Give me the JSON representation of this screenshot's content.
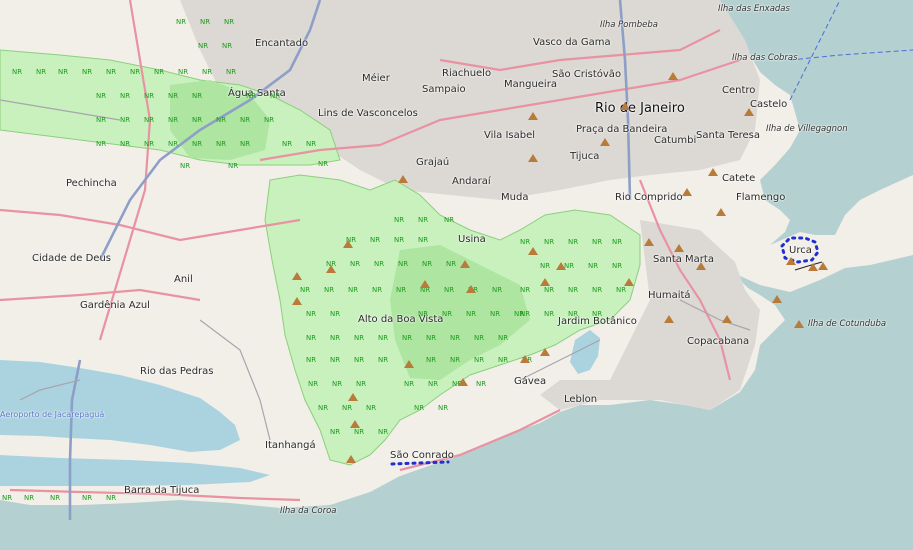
{
  "colors": {
    "sea": "#b5d0d0",
    "land": "#f2efe9",
    "urban": "#dcd9d4",
    "park": "#c8f1bd",
    "park_dark": "#aee5a1",
    "lagoon": "#aad3df",
    "road_major": "#e892a2",
    "road_motorway": "#8d9fc7",
    "route": "#1f2fd0"
  },
  "map": {
    "places": [
      {
        "id": "encantado",
        "name": "Encantado"
      },
      {
        "id": "agua-santa",
        "name": "Água Santa"
      },
      {
        "id": "meier",
        "name": "Méier"
      },
      {
        "id": "riachuelo",
        "name": "Riachuelo"
      },
      {
        "id": "vasco",
        "name": "Vasco da Gama"
      },
      {
        "id": "ilha-pombeba",
        "name": "Ilha Pombeba",
        "kind": "island"
      },
      {
        "id": "ilha-enxadas",
        "name": "Ilha das Enxadas",
        "kind": "island"
      },
      {
        "id": "ilha-cobras",
        "name": "Ilha das Cobras",
        "kind": "island"
      },
      {
        "id": "sampaio",
        "name": "Sampaio"
      },
      {
        "id": "mangueira",
        "name": "Mangueira"
      },
      {
        "id": "sao-cristovao",
        "name": "São Cristóvão"
      },
      {
        "id": "rio",
        "name": "Rio de Janeiro",
        "kind": "big"
      },
      {
        "id": "centro",
        "name": "Centro"
      },
      {
        "id": "castelo",
        "name": "Castelo"
      },
      {
        "id": "lins",
        "name": "Lins de Vasconcelos"
      },
      {
        "id": "vila-isabel",
        "name": "Vila Isabel"
      },
      {
        "id": "praca-bandeira",
        "name": "Praça da Bandeira"
      },
      {
        "id": "catumbi",
        "name": "Catumbi"
      },
      {
        "id": "santa-teresa",
        "name": "Santa Teresa"
      },
      {
        "id": "ilha-villegagnon",
        "name": "Ilha de Villegagnon",
        "kind": "island"
      },
      {
        "id": "grajau",
        "name": "Grajaú"
      },
      {
        "id": "tijuca",
        "name": "Tijuca"
      },
      {
        "id": "pechincha",
        "name": "Pechincha"
      },
      {
        "id": "andarai",
        "name": "Andaraí"
      },
      {
        "id": "catete",
        "name": "Catete"
      },
      {
        "id": "muda",
        "name": "Muda"
      },
      {
        "id": "rio-comprido",
        "name": "Rio Comprido"
      },
      {
        "id": "flamengo",
        "name": "Flamengo"
      },
      {
        "id": "usina",
        "name": "Usina"
      },
      {
        "id": "urca",
        "name": "Urca"
      },
      {
        "id": "cidade-deus",
        "name": "Cidade de Deus"
      },
      {
        "id": "santa-marta",
        "name": "Santa Marta"
      },
      {
        "id": "anil",
        "name": "Anil"
      },
      {
        "id": "humaita",
        "name": "Humaitá"
      },
      {
        "id": "gardenia",
        "name": "Gardênia Azul"
      },
      {
        "id": "alto-boa-vista",
        "name": "Alto da Boa Vista"
      },
      {
        "id": "jardim-botanico",
        "name": "Jardim Botânico"
      },
      {
        "id": "ilha-cotunduba",
        "name": "Ilha de Cotunduba",
        "kind": "island"
      },
      {
        "id": "copacabana",
        "name": "Copacabana"
      },
      {
        "id": "rio-pedras",
        "name": "Rio das Pedras"
      },
      {
        "id": "gavea",
        "name": "Gávea"
      },
      {
        "id": "aeroporto",
        "name": "Aeroporto de Jacarepaguá",
        "kind": "airport"
      },
      {
        "id": "leblon",
        "name": "Leblon"
      },
      {
        "id": "itanhanga",
        "name": "Itanhangá"
      },
      {
        "id": "sao-conrado",
        "name": "São Conrado"
      },
      {
        "id": "barra",
        "name": "Barra da Tijuca"
      },
      {
        "id": "ilha-coroa",
        "name": "Ilha da Coroa",
        "kind": "island"
      }
    ],
    "nature_reserve_mark": "NR",
    "peak_symbol": "peak-triangle-icon"
  }
}
